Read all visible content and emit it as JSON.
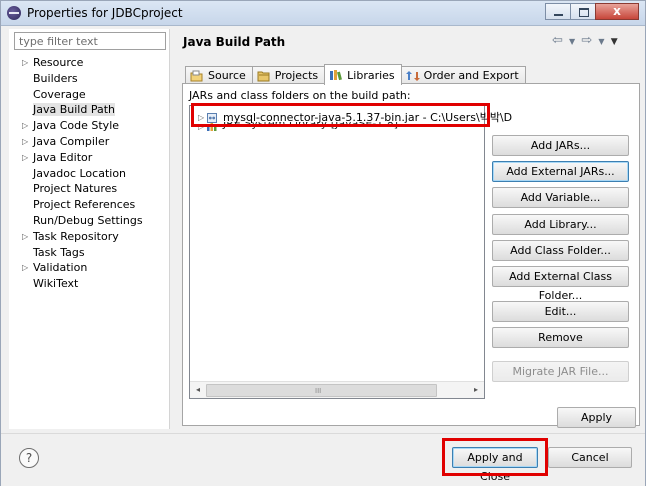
{
  "window": {
    "title": "Properties for JDBCproject",
    "min_icon": "minimize-icon",
    "max_icon": "maximize-icon",
    "close_glyph": "x"
  },
  "filter": {
    "placeholder": "type filter text",
    "value": ""
  },
  "tree": [
    {
      "label": "Resource",
      "expandable": true
    },
    {
      "label": "Builders",
      "expandable": false
    },
    {
      "label": "Coverage",
      "expandable": false
    },
    {
      "label": "Java Build Path",
      "expandable": false,
      "selected": true
    },
    {
      "label": "Java Code Style",
      "expandable": true
    },
    {
      "label": "Java Compiler",
      "expandable": true
    },
    {
      "label": "Java Editor",
      "expandable": true
    },
    {
      "label": "Javadoc Location",
      "expandable": false
    },
    {
      "label": "Project Natures",
      "expandable": false
    },
    {
      "label": "Project References",
      "expandable": false
    },
    {
      "label": "Run/Debug Settings",
      "expandable": false
    },
    {
      "label": "Task Repository",
      "expandable": true
    },
    {
      "label": "Task Tags",
      "expandable": false
    },
    {
      "label": "Validation",
      "expandable": true
    },
    {
      "label": "WikiText",
      "expandable": false
    }
  ],
  "page": {
    "title": "Java Build Path",
    "nav_back": "⇦",
    "nav_fwd": "⇨",
    "menu": "▼"
  },
  "tabs": [
    {
      "label": "Source",
      "icon": "source-folder-icon"
    },
    {
      "label": "Projects",
      "icon": "projects-icon"
    },
    {
      "label": "Libraries",
      "icon": "libraries-icon",
      "active": true
    },
    {
      "label": "Order and Export",
      "icon": "order-export-icon"
    }
  ],
  "libraries": {
    "heading": "JARs and class folders on the build path:",
    "entries": [
      {
        "label": "mysql-connector-java-5.1.37-bin.jar - C:\\Users\\박박\\D",
        "icon": "jar-icon"
      },
      {
        "label": "JRE System Library [JavaSE-1.8]",
        "icon": "library-icon"
      }
    ],
    "scroll_grip": "III",
    "scroll_left": "◂",
    "scroll_right": "▸"
  },
  "buttons": {
    "add_jars": "Add JARs...",
    "add_external_jars": "Add External JARs...",
    "add_variable": "Add Variable...",
    "add_library": "Add Library...",
    "add_class_folder": "Add Class Folder...",
    "add_external_class_folder": "Add External Class Folder...",
    "edit": "Edit...",
    "remove": "Remove",
    "migrate_jar": "Migrate JAR File...",
    "apply": "Apply",
    "apply_and_close": "Apply and Close",
    "cancel": "Cancel",
    "help": "?"
  },
  "colors": {
    "highlight": "#e00000",
    "selection": "#e3e3e3",
    "titlebar": "#c7d6ea"
  }
}
